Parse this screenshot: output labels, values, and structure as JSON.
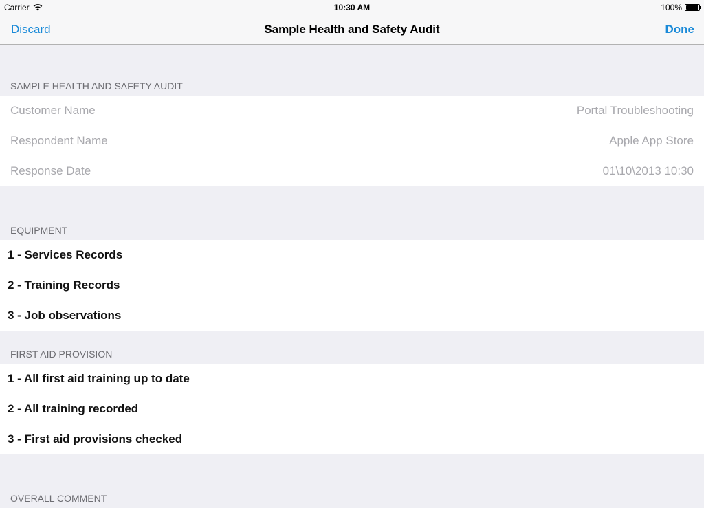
{
  "status_bar": {
    "carrier": "Carrier",
    "time": "10:30 AM",
    "battery": "100%",
    "battery_level": 1.0
  },
  "nav": {
    "discard_label": "Discard",
    "title": "Sample Health and Safety Audit",
    "done_label": "Done",
    "accent_color": "#1a8ad8"
  },
  "audit_info": {
    "header": "Sample Health and Safety Audit",
    "rows": [
      {
        "label": "Customer Name",
        "value": "Portal Troubleshooting"
      },
      {
        "label": "Respondent Name",
        "value": "Apple App Store"
      },
      {
        "label": "Response Date",
        "value": "01\\10\\2013 10:30"
      }
    ]
  },
  "equipment": {
    "header": "Equipment",
    "items": [
      "1 - Services Records",
      "2 - Training Records",
      "3 - Job observations"
    ]
  },
  "first_aid": {
    "header": "First Aid Provision",
    "items": [
      "1 - All first aid training up to date",
      "2 - All training recorded",
      "3 - First aid provisions checked"
    ]
  },
  "overall_comment": {
    "header": "Overall Comment"
  }
}
